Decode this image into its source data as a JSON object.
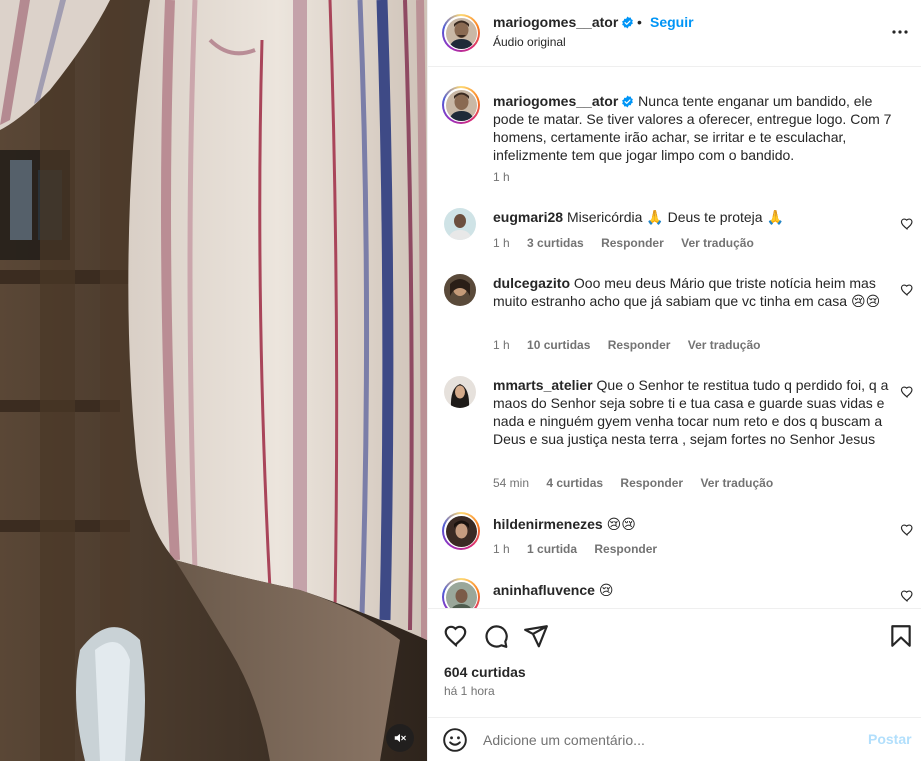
{
  "header": {
    "username": "mariogomes__ator",
    "separator": "•",
    "follow_label": "Seguir",
    "audio": "Áudio original",
    "more_icon": "more-horizontal-icon"
  },
  "caption": {
    "username": "mariogomes__ator",
    "text": "Nunca tente enganar um bandido, ele pode te matar. Se tiver valores a oferecer, entregue logo. Com 7 homens, certamente irão achar, se irritar e te esculachar, infelizmente tem que jogar limpo com o bandido.",
    "time": "1 h"
  },
  "comments": [
    {
      "username": "eugmari28",
      "text": "Misericórdia 🙏 Deus te proteja 🙏",
      "time": "1 h",
      "likes": "3 curtidas",
      "reply": "Responder",
      "translate": "Ver tradução"
    },
    {
      "username": "dulcegazito",
      "text": "Ooo meu deus Mário que triste notícia heim mas muito estranho acho que já sabiam que vc tinha em casa 😢😢",
      "time": "1 h",
      "likes": "10 curtidas",
      "reply": "Responder",
      "translate": "Ver tradução"
    },
    {
      "username": "mmarts_atelier",
      "text": "Que o Senhor te restitua tudo q perdido foi, q a maos do Senhor seja sobre ti e tua casa e guarde suas vidas e nada e ninguém gyem venha tocar num reto e dos q buscam a Deus e sua justiça nesta terra , sejam fortes no Senhor Jesus",
      "time": "54 min",
      "likes": "4 curtidas",
      "reply": "Responder",
      "translate": "Ver tradução"
    },
    {
      "username": "hildenirmenezes",
      "text": "😢😢",
      "time": "1 h",
      "likes": "1 curtida",
      "reply": "Responder"
    },
    {
      "username": "aninhafluvence",
      "text": "😢"
    }
  ],
  "actions": {
    "likes": "604 curtidas",
    "time": "há 1 hora"
  },
  "add_comment": {
    "placeholder": "Adicione um comentário...",
    "post_label": "Postar"
  },
  "colors": {
    "link_blue": "#0095f6",
    "post_disabled": "#b2dffc",
    "meta_gray": "#737373",
    "verified": "#0095f6"
  }
}
